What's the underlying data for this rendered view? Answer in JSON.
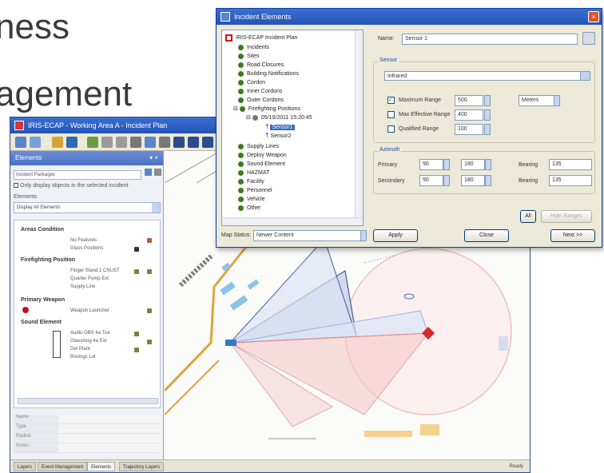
{
  "slide": {
    "line1": "ness",
    "line2": "agement"
  },
  "map_window": {
    "title": "IRIS-ECAP - Working Area A - Incident Plan",
    "left_panel": {
      "header": "Elements",
      "scenario": "Incident Packages",
      "checkbox_label": "Only display objects in the selected incident",
      "filter_label": "Elements",
      "filter_value": "Display All Elements",
      "groups": [
        {
          "label": "Areas Condition",
          "items": [
            "No Features",
            "Glass Positions"
          ]
        },
        {
          "label": "Firefighting Position",
          "items": [
            "Finger Stand 1 CNUST",
            "Quarter Pump Ext",
            "Supply Line"
          ]
        },
        {
          "label": "Primary Weapon",
          "items": [
            "Weapon Launcher"
          ]
        },
        {
          "label": "Sound Element",
          "items": [
            "Audio OBS 4a Tue",
            "Glasslong 4a Ext",
            "Det Plant",
            "Rovings Lot"
          ]
        }
      ],
      "props": [
        "Name",
        "Type",
        "Radius",
        "Notes"
      ]
    },
    "status_tabs": [
      "Layers",
      "Event Management",
      "Elements",
      "Trajectory Layers"
    ],
    "status_right": "Ready"
  },
  "dialog": {
    "title": "Incident Elements",
    "close_label": "×",
    "tree": {
      "root": "IRIS-ECAP Incident Plan",
      "items": [
        "Incidents",
        "Sites",
        "Road Closures",
        "Building Notifications",
        "Cordon",
        "Inner Cordons",
        "Outer Cordons",
        "Firefighting Positions"
      ],
      "sub_item": "05/10/2011 15:20:45",
      "sensor_selected": "Sensor1",
      "sensor_second": "Sensor2",
      "after_items": [
        "Supply Lines",
        "Deploy Weapon",
        "Sound Element",
        "HAZMAT",
        "Facility",
        "Personnel",
        "Vehicle",
        "Other"
      ]
    },
    "name_label": "Name:",
    "name_value": "Sensor 1",
    "sensor_group_label": "Sensor",
    "sensor_type": "Infrared",
    "ranges": [
      {
        "label": "Maximum Range",
        "value": "500",
        "checked": true
      },
      {
        "label": "Max Effective Range",
        "value": "400",
        "checked": false
      },
      {
        "label": "Qualified Range",
        "value": "100",
        "checked": false
      }
    ],
    "units": "Meters",
    "angle_group_label": "Azimuth",
    "angle_rows": [
      {
        "label": "Primary",
        "from": "90",
        "to": "180",
        "bearing_label": "Bearing",
        "bearing": "135"
      },
      {
        "label": "Secondary",
        "from": "90",
        "to": "180",
        "bearing_label": "Bearing",
        "bearing": "135"
      }
    ],
    "all_button": "All",
    "hide_button": "Hide Ranges",
    "map_status_label": "Map Status:",
    "map_status_value": "Newer Content",
    "apply_button": "Apply",
    "close_button": "Close",
    "next_button": "Next >>",
    "colors": {
      "title_blue": "#2453b7",
      "selection": "#316ac5",
      "sector_blue": "#4b6fb5",
      "sector_red": "#e5a5a5"
    }
  }
}
